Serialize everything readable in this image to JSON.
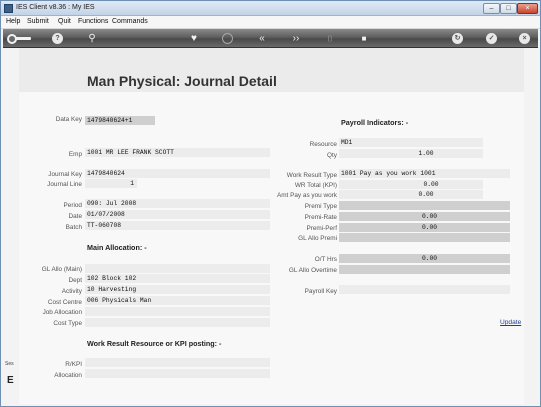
{
  "window": {
    "title": "IES Client v8.36 : My IES",
    "min": "–",
    "max": "□",
    "close": "×"
  },
  "menu": [
    "Help",
    "Submit",
    "Quit",
    "Functions",
    "Commands"
  ],
  "toolbar": {
    "help": "?",
    "search": "⚲",
    "fav": "♥",
    "prev_first": "«",
    "prev": "‹‹",
    "next": "››",
    "stop": "■",
    "refresh": "↻",
    "ok": "✓",
    "cancel": "×"
  },
  "page": {
    "title": "Man Physical: Journal Detail"
  },
  "left": {
    "data_key": {
      "label": "Data Key",
      "value": "1479840624+1"
    },
    "emp": {
      "label": "Emp",
      "value": "1001 MR LEE FRANK SCOTT"
    },
    "journal_key": {
      "label": "Journal Key",
      "value": "1479840624"
    },
    "journal_line": {
      "label": "Journal Line",
      "value": "1"
    },
    "period": {
      "label": "Period",
      "value": "090: Jul 2008"
    },
    "date": {
      "label": "Date",
      "value": "01/07/2008"
    },
    "batch": {
      "label": "Batch",
      "value": "TT-060708"
    }
  },
  "main_allocation": {
    "heading": "Main Allocation: -",
    "gl_allo_main": {
      "label": "GL Allo (Main)",
      "value": ""
    },
    "dept": {
      "label": "Dept",
      "value": "102 Block 102"
    },
    "activity": {
      "label": "Activity",
      "value": "10 Harvesting"
    },
    "cost_centre": {
      "label": "Cost Centre",
      "value": "006 Physicals Man"
    },
    "job_allocation": {
      "label": "Job Allocation",
      "value": ""
    },
    "cost_type": {
      "label": "Cost Type",
      "value": ""
    }
  },
  "kpi": {
    "heading": "Work Result Resource or KPI posting: -",
    "rkpi": {
      "label": "R/KPI",
      "value": ""
    },
    "allocation": {
      "label": "Allocation",
      "value": ""
    }
  },
  "payroll": {
    "heading": "Payroll Indicators: -",
    "resource": {
      "label": "Resource",
      "value": "MD1"
    },
    "qty": {
      "label": "Qty",
      "value": "1.00"
    },
    "work_result_type": {
      "label": "Work Result Type",
      "value": "1001 Pay as you work 1001"
    },
    "wr_total": {
      "label": "WR Total (KPI)",
      "value": "0.00"
    },
    "amt_pay": {
      "label": "Amt Pay as you work",
      "value": "0.00"
    },
    "premi_type": {
      "label": "Premi Type",
      "value": ""
    },
    "premi_rate": {
      "label": "Premi-Rate",
      "value": "0.00"
    },
    "premi_perf": {
      "label": "Premi-Perf",
      "value": "0.00"
    },
    "gl_allo_premi": {
      "label": "GL Allo Premi",
      "value": ""
    },
    "ot_hrs": {
      "label": "O/T Hrs",
      "value": "0.00"
    },
    "gl_allo_overtime": {
      "label": "GL Allo Overtime",
      "value": ""
    },
    "payroll_key": {
      "label": "Payroll Key",
      "value": ""
    },
    "update_label": "Update"
  },
  "edge": {
    "text": "Ses",
    "glyph": "E"
  }
}
